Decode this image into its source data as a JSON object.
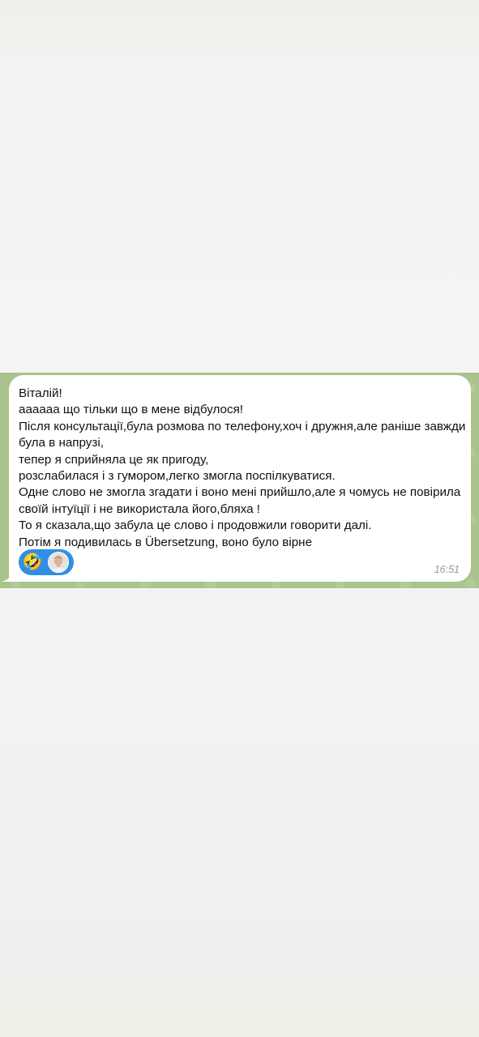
{
  "message": {
    "text": "Віталій!\nаааааа що тільки що в мене відбулося!\nПісля консультації,була розмова по телефону,хоч і дружня,але раніше завжди була в напрузі,\nтепер я сприйняла це як пригоду,\nрозслабилася і з гумором,легко змогла поспілкуватися.\nОдне слово не змогла згадати і воно мені прийшло,але я чомусь не повірила своїй інтуїції і не використала його,бляха !\nТо я сказала,що забула це слово і продовжили говорити далі.\nПотім я подивилась в Übersetzung, воно було вірне",
    "time": "16:51"
  },
  "reactions": {
    "emoji": "🤣",
    "avatar_icon": "user-avatar",
    "pill_color": "#2f8fe6"
  },
  "colors": {
    "chat_background": "#a9c48c",
    "bubble": "#ffffff"
  }
}
